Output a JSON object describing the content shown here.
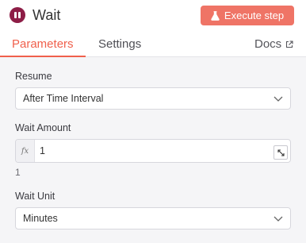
{
  "header": {
    "title": "Wait",
    "node_icon": "pause-circle-icon",
    "execute_label": "Execute step",
    "execute_icon": "flask-icon",
    "accent_color": "#ef7466",
    "node_color": "#8d1d46"
  },
  "tabs": [
    {
      "label": "Parameters",
      "active": true
    },
    {
      "label": "Settings",
      "active": false
    }
  ],
  "docs": {
    "label": "Docs",
    "icon": "external-link-icon"
  },
  "fields": {
    "resume": {
      "label": "Resume",
      "value": "After Time Interval"
    },
    "wait_amount": {
      "label": "Wait Amount",
      "value": "1",
      "preview": "1",
      "fx_label": "fx"
    },
    "wait_unit": {
      "label": "Wait Unit",
      "value": "Minutes"
    }
  }
}
